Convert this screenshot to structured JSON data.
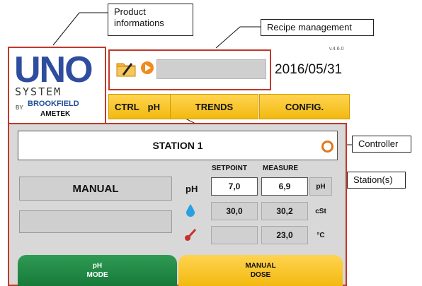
{
  "callouts": {
    "product": "Product informations",
    "recipe": "Recipe management",
    "controller": "Controller",
    "stations": "Station(s)"
  },
  "brand": {
    "uno": "UNO",
    "system": "SYSTEM",
    "by": "BY",
    "brookfield": "BROOKFIELD",
    "ametek": "AMETEK",
    "primary_color": "#2f4d9e"
  },
  "header": {
    "version": "v.4.6.0",
    "date": "2016/05/31"
  },
  "tabs": {
    "ctrl": "CTRL",
    "ph": "pH",
    "trends": "TRENDS",
    "config": "CONFIG."
  },
  "station": {
    "title": "STATION 1",
    "mode": "MANUAL",
    "col_setpoint": "SETPOINT",
    "col_measure": "MEASURE",
    "rows": [
      {
        "label": "pH",
        "setpoint": "7,0",
        "measure": "6,9",
        "unit": "pH"
      },
      {
        "icon": "viscosity-drop-icon",
        "setpoint": "30,0",
        "measure": "30,2",
        "unit": "cSt"
      },
      {
        "icon": "thermometer-icon",
        "setpoint": "",
        "measure": "23,0",
        "unit": "°C"
      }
    ]
  },
  "buttons": {
    "ph_mode_1": "pH",
    "ph_mode_2": "MODE",
    "manual_dose_1": "MANUAL",
    "manual_dose_2": "DOSE"
  },
  "colors": {
    "frame": "#c0392b",
    "tab": "#f2b90f",
    "green": "#2f9b53",
    "orange": "#f08a1c"
  }
}
